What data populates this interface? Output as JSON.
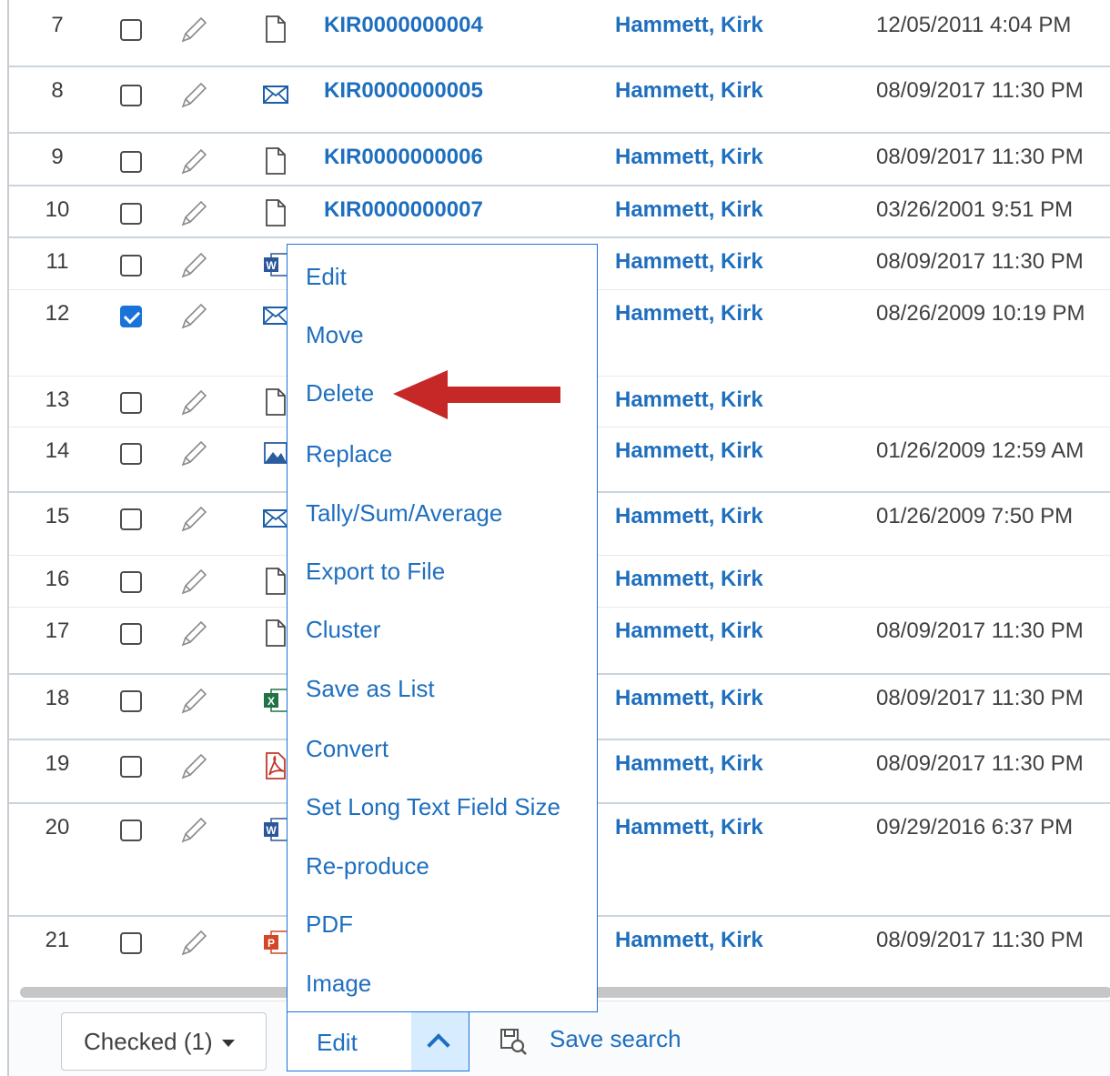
{
  "rows": [
    {
      "num": "7",
      "checked": false,
      "icon": "document-icon",
      "control": "KIR0000000004",
      "custodian": "Hammett, Kirk",
      "date": "12/05/2011 4:04 PM"
    },
    {
      "num": "8",
      "checked": false,
      "icon": "email-icon",
      "control": "KIR0000000005",
      "custodian": "Hammett, Kirk",
      "date": "08/09/2017 11:30 PM"
    },
    {
      "num": "9",
      "checked": false,
      "icon": "document-icon",
      "control": "KIR0000000006",
      "custodian": "Hammett, Kirk",
      "date": "08/09/2017 11:30 PM"
    },
    {
      "num": "10",
      "checked": false,
      "icon": "document-icon",
      "control": "KIR0000000007",
      "custodian": "Hammett, Kirk",
      "date": "03/26/2001 9:51 PM"
    },
    {
      "num": "11",
      "checked": false,
      "icon": "word-icon",
      "control": "",
      "custodian": "Hammett, Kirk",
      "date": "08/09/2017 11:30 PM"
    },
    {
      "num": "12",
      "checked": true,
      "icon": "email-icon",
      "control": "",
      "custodian": "Hammett, Kirk",
      "date": "08/26/2009 10:19 PM"
    },
    {
      "num": "13",
      "checked": false,
      "icon": "document-icon",
      "control": "",
      "custodian": "Hammett, Kirk",
      "date": ""
    },
    {
      "num": "14",
      "checked": false,
      "icon": "image-icon",
      "control": "",
      "custodian": "Hammett, Kirk",
      "date": "01/26/2009 12:59 AM"
    },
    {
      "num": "15",
      "checked": false,
      "icon": "email-icon",
      "control": "",
      "custodian": "Hammett, Kirk",
      "date": "01/26/2009 7:50 PM"
    },
    {
      "num": "16",
      "checked": false,
      "icon": "document-icon",
      "control": "",
      "custodian": "Hammett, Kirk",
      "date": ""
    },
    {
      "num": "17",
      "checked": false,
      "icon": "document-icon",
      "control": "",
      "custodian": "Hammett, Kirk",
      "date": "08/09/2017 11:30 PM"
    },
    {
      "num": "18",
      "checked": false,
      "icon": "excel-icon",
      "control": "",
      "custodian": "Hammett, Kirk",
      "date": "08/09/2017 11:30 PM"
    },
    {
      "num": "19",
      "checked": false,
      "icon": "pdf-icon",
      "control": "",
      "custodian": "Hammett, Kirk",
      "date": "08/09/2017 11:30 PM"
    },
    {
      "num": "20",
      "checked": false,
      "icon": "word-icon",
      "control": "",
      "custodian": "Hammett, Kirk",
      "date": "09/29/2016 6:37 PM"
    },
    {
      "num": "21",
      "checked": false,
      "icon": "powerpoint-icon",
      "control": "",
      "custodian": "Hammett, Kirk",
      "date": "08/09/2017 11:30 PM"
    }
  ],
  "menu": {
    "items": [
      "Edit",
      "Move",
      "Delete",
      "Replace",
      "Tally/Sum/Average",
      "Export to File",
      "Cluster",
      "Save as List",
      "Convert",
      "Set Long Text Field Size",
      "Re-produce",
      "PDF",
      "Image"
    ]
  },
  "footer": {
    "checked_dropdown": "Checked (1)",
    "edit_button": "Edit",
    "save_search": "Save search"
  },
  "colors": {
    "link": "#1f6fbf",
    "accent": "#1a73d9",
    "arrow": "#c62828"
  }
}
